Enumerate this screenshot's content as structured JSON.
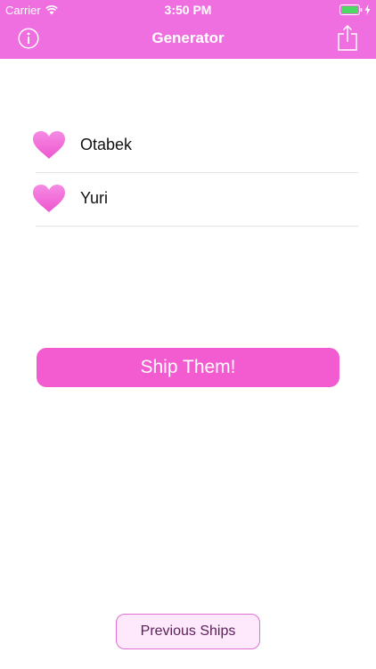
{
  "status_bar": {
    "carrier": "Carrier",
    "time": "3:50 PM",
    "icons": [
      "wifi-icon",
      "battery-icon",
      "charging-bolt-icon"
    ]
  },
  "nav": {
    "title": "Generator",
    "left_icon": "info-icon",
    "right_icon": "share-icon"
  },
  "names": [
    {
      "label": "Otabek",
      "icon": "heart-icon"
    },
    {
      "label": "Yuri",
      "icon": "heart-icon"
    }
  ],
  "ship_button": {
    "label": "Ship Them!"
  },
  "previous_button": {
    "label": "Previous Ships"
  },
  "colors": {
    "bar": "#ef6fe0",
    "accent": "#f35bd1",
    "heart": "#f26bd6",
    "secondary_fill": "#fde9fb",
    "secondary_text": "#5a1f58"
  }
}
